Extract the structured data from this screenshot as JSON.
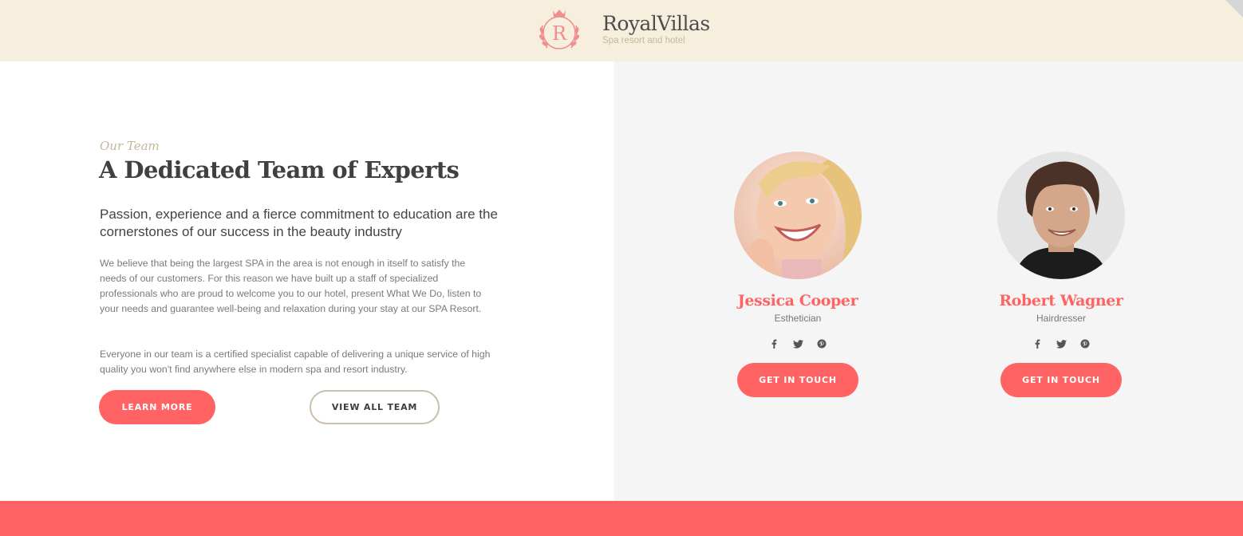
{
  "header": {
    "logo_letter": "R",
    "brand_name": "RoyalVillas",
    "tagline": "Spa resort and hotel"
  },
  "team_intro": {
    "eyebrow": "Our Team",
    "title": "A Dedicated Team of Experts",
    "lead": "Passion, experience and a fierce commitment to education are the cornerstones of our success in the beauty industry",
    "paragraph1": "We believe that being the largest SPA in the area is not enough in itself to satisfy the needs of our customers. For this reason we have built up a staff of specialized professionals who are proud to welcome you to our hotel, present What We Do, listen to your needs and guarantee well-being and relaxation during your stay at our SPA Resort.",
    "paragraph2": "Everyone in our team is a certified specialist capable of delivering a unique service of high quality you won't find anywhere else in modern spa and resort industry.",
    "learn_more_label": "LEARN MORE",
    "view_team_label": "VIEW ALL TEAM"
  },
  "members": [
    {
      "name": "Jessica Cooper",
      "role": "Esthetician",
      "socials": [
        "facebook-icon",
        "twitter-icon",
        "pinterest-icon"
      ],
      "cta_label": "GET IN TOUCH"
    },
    {
      "name": "Robert Wagner",
      "role": "Hairdresser",
      "socials": [
        "facebook-icon",
        "twitter-icon",
        "pinterest-icon"
      ],
      "cta_label": "GET IN TOUCH"
    }
  ],
  "colors": {
    "accent": "#ff6363",
    "header_bg": "#f7efdd",
    "muted_gold": "#c4b79c",
    "panel_bg": "#f5f5f5"
  }
}
